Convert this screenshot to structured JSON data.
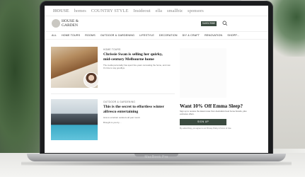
{
  "device": {
    "brand_label": "MacBook Pro"
  },
  "site": {
    "brand_bar": [
      "HOUSE",
      "homes",
      "COUNTRY STYLE",
      "Insideout",
      "ella",
      "smallbiz",
      "sponsors"
    ],
    "logo_text": "HOUSE &",
    "logo_text_2": "GARDEN",
    "subscribe_label": "SUBSCRIBE",
    "nav": [
      "ALL",
      "HOME TOURS",
      "ROOMS",
      "OUTDOOR & GARDENING",
      "LIFESTYLE",
      "DECORATION",
      "DIY & CRAFT",
      "RENOVATION",
      "SHOPP..."
    ]
  },
  "articles": [
    {
      "tag": "HOME TOURS",
      "headline": "Chrissie Swan is selling her quirky, mid-century Melbourne home",
      "summary": "The media personality has spent five years renovating the home, and now it's time to say goodbye."
    },
    {
      "tag": "OUTDOOR & GARDENING",
      "headline": "This is the secret to effortless winter alfresco entertaining",
      "summary": "How to entertain outdoors all year round.",
      "byline": "Brought to you by ..."
    }
  ],
  "promo": {
    "title": "Want 10% Off Emma Sleep?",
    "body": "Sign up to receive the latest news from Australia's best home brands, plus exclusive offers.",
    "button_label": "SIGN UP",
    "fine_print": "By subscribing, you agree to our Privacy Policy & Terms of Use."
  },
  "colors": {
    "accent": "#3b4b40"
  }
}
